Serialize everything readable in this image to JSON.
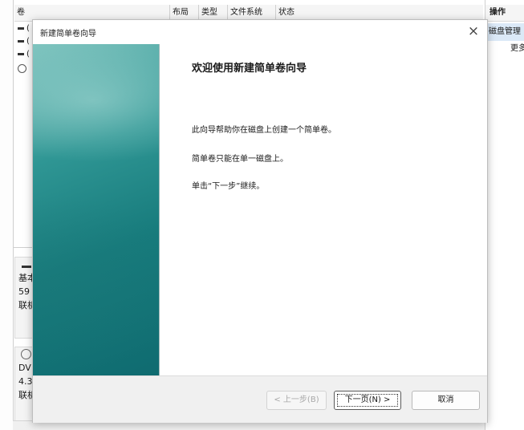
{
  "background": {
    "columns": [
      "卷",
      "布局",
      "类型",
      "文件系统",
      "状态"
    ],
    "volume_markers": [
      "(",
      "(",
      "("
    ],
    "disk0": {
      "label": "基本",
      "size": "59",
      "status": "联机"
    },
    "disk1": {
      "label": "DV",
      "size": "4.3",
      "status": "联机"
    },
    "actions_title": "操作",
    "actions_selected": "磁盘管理",
    "actions_more": "更多"
  },
  "wizard": {
    "title": "新建简单卷向导",
    "close_glyph": "×",
    "heading": "欢迎使用新建简单卷向导",
    "paragraphs": [
      "此向导帮助你在磁盘上创建一个简单卷。",
      "简单卷只能在单一磁盘上。",
      "单击“下一步”继续。"
    ],
    "buttons": {
      "back": "< 上一步(B)",
      "next": "下一页(N) >",
      "cancel": "取消"
    }
  }
}
